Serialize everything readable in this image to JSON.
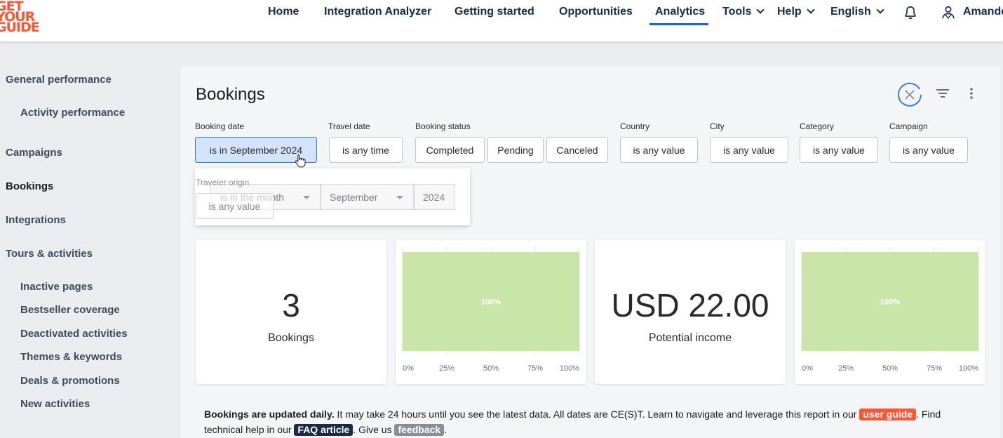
{
  "brand": {
    "logo_lines": [
      "GET",
      "YOUR",
      "GUIDE"
    ],
    "accent": "#ff5533",
    "nav_text": "#1a2b49",
    "active_underline": "#1a64d6"
  },
  "nav": {
    "items": [
      {
        "label": "Home"
      },
      {
        "label": "Integration Analyzer"
      },
      {
        "label": "Getting started"
      },
      {
        "label": "Opportunities"
      },
      {
        "label": "Analytics",
        "active": true
      },
      {
        "label": "Tools",
        "dropdown": true
      },
      {
        "label": "Help",
        "dropdown": true
      },
      {
        "label": "English",
        "dropdown": true
      }
    ],
    "notifications_icon": "bell-icon",
    "user_icon": "user-icon",
    "user_name": "Amande"
  },
  "sidebar": {
    "items": [
      {
        "label": "General performance"
      },
      {
        "label": "Activity performance"
      },
      {
        "label": "Campaigns"
      },
      {
        "label": "Bookings",
        "active": true
      },
      {
        "label": "Integrations"
      },
      {
        "label": "Tours & activities"
      },
      {
        "label": "Inactive pages"
      },
      {
        "label": "Bestseller coverage"
      },
      {
        "label": "Deactivated activities"
      },
      {
        "label": "Themes & keywords"
      },
      {
        "label": "Deals & promotions"
      },
      {
        "label": "New activities"
      }
    ]
  },
  "page": {
    "title": "Bookings",
    "header_icons": [
      "close-circle-icon",
      "filter-icon",
      "more-vertical-icon"
    ]
  },
  "filters": {
    "booking_date": {
      "label": "Booking date",
      "value": "is in September 2024"
    },
    "travel_date": {
      "label": "Travel date",
      "value": "is any time"
    },
    "booking_status": {
      "label": "Booking status",
      "options": [
        "Completed",
        "Pending",
        "Canceled"
      ]
    },
    "country": {
      "label": "Country",
      "value": "is any value"
    },
    "city": {
      "label": "City",
      "value": "is any value"
    },
    "category": {
      "label": "Category",
      "value": "is any value"
    },
    "campaign": {
      "label": "Campaign",
      "value": "is any value"
    },
    "traveler_origin": {
      "label": "Traveler origin",
      "value": "is any value"
    }
  },
  "date_dropdown": {
    "operator": "is in the month",
    "month": "September",
    "year": "2024"
  },
  "kpis": {
    "bookings": {
      "value": "3",
      "label": "Bookings"
    },
    "income": {
      "value": "USD 22.00",
      "label": "Potential income"
    }
  },
  "chart_data": [
    {
      "type": "bar",
      "orientation": "horizontal",
      "stacked": "percent",
      "categories": [
        ""
      ],
      "series": [
        {
          "values": [
            100
          ]
        }
      ],
      "data_labels": [
        "100%"
      ],
      "x_ticks": [
        "0%",
        "25%",
        "50%",
        "75%",
        "100%"
      ],
      "xlim": [
        0,
        100
      ],
      "grid": true,
      "color": "#c9e5a8"
    },
    {
      "type": "bar",
      "orientation": "horizontal",
      "stacked": "percent",
      "categories": [
        ""
      ],
      "series": [
        {
          "values": [
            100
          ]
        }
      ],
      "data_labels": [
        "100%"
      ],
      "x_ticks": [
        "0%",
        "25%",
        "50%",
        "75%",
        "100%"
      ],
      "xlim": [
        0,
        100
      ],
      "grid": true,
      "color": "#c9e5a8"
    }
  ],
  "footer": {
    "bold_lead": "Bookings are updated daily.",
    "text_1": " It may take 24 hours until you see the latest data. All dates are CE(S)T. Learn to navigate and leverage this report in our ",
    "link_user_guide": "user guide",
    "text_2": ". Find technical help in our ",
    "link_faq": "FAQ article",
    "text_3": ". Give us ",
    "link_feedback": "feedback",
    "text_4": "."
  }
}
